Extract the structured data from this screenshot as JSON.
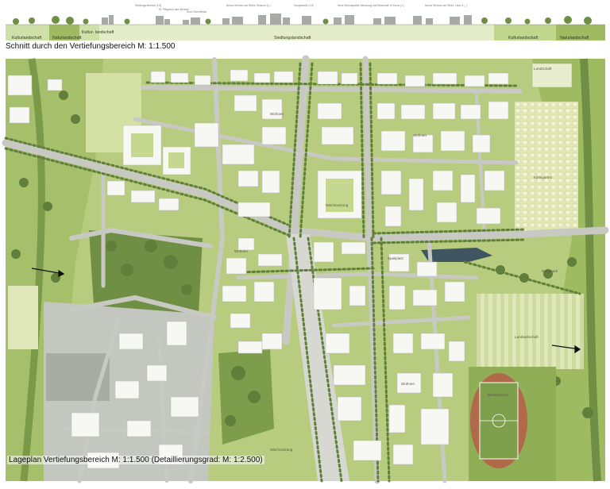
{
  "section": {
    "title": "Schnitt durch den Vertiefungsbereich M: 1:1.500",
    "zones": [
      "Kulturlandschaft",
      "Naturlandschaft",
      "Kultur- landschaft",
      "Siedlungslandschaft",
      "Kulturlandschaft",
      "Naturlandschaft"
    ],
    "building_labels": [
      "Siedlungs-Bereich (1:5)",
      "St. Pfingstvor dem Bereich",
      "Sport Schuhfelder",
      "Neues Wohnen am Steinr. Zentrum (1.)",
      "Hauptstraße (1:5)",
      "Neue Wohnquartier-Bebauung und Wirtschaft 10-Kreuz (1.)",
      "Neues Wohnen am Steinr. Laue 4 (...)"
    ]
  },
  "plan": {
    "title": "Lageplan Vertiefungsbereich M: 1:1.500 (Detaillierungsgrad: M: 1:2.500)",
    "labels": {
      "landschaft": "Landschaft",
      "kleingarten": "Kleingarten",
      "mischnutzung_north": "Mischnutzung",
      "wohnen_north": "Wohnen",
      "wohnen_center": "Wohnen",
      "wohnen_east": "Wohnen",
      "wohnen_south": "Wohnen",
      "spielplatz": "Spielplatz",
      "naturpark": "Naturpark",
      "landwirtschaft": "Landwirtschaft",
      "bezirkssport": "Bezirkssport",
      "mischnutzung_south": "Mischnutzung"
    }
  },
  "colors": {
    "meadow": "#b7cc7e",
    "light_meadow": "#d5e0a4",
    "forest_green": "#8fae56",
    "road": "#c9c9c4",
    "building": "#f7f7f3",
    "water": "#3f5560",
    "track": "#b06a4a",
    "sport_field": "#7ea04d"
  }
}
